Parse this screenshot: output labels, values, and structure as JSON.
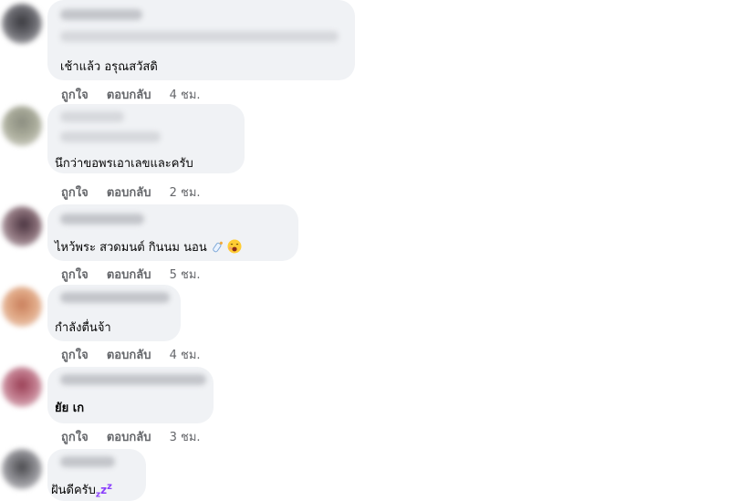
{
  "labels": {
    "like": "ถูกใจ",
    "reply": "ตอบกลับ"
  },
  "comments": [
    {
      "text": "เช้าแล้ว อรุณสวัสดิ",
      "time": "4 ชม."
    },
    {
      "text": "นึกว่าขอพรเอาเลขและครับ",
      "time": "2 ชม."
    },
    {
      "text": "ไหว้พระ สวดมนต์ กินนม นอน",
      "time": "5 ชม.",
      "emojis": [
        "baby-bottle-icon",
        "yawning-face-icon"
      ]
    },
    {
      "text": "กำลังตื่นจ้า",
      "time": "4 ชม."
    },
    {
      "text": "ยัย เก",
      "time": "3 ชม."
    },
    {
      "text": "ฝันดีครับ",
      "emojis": [
        "zzz-icon"
      ]
    }
  ],
  "colors": {
    "bubble": "#f0f2f5",
    "action": "#65676b",
    "text": "#050505"
  }
}
